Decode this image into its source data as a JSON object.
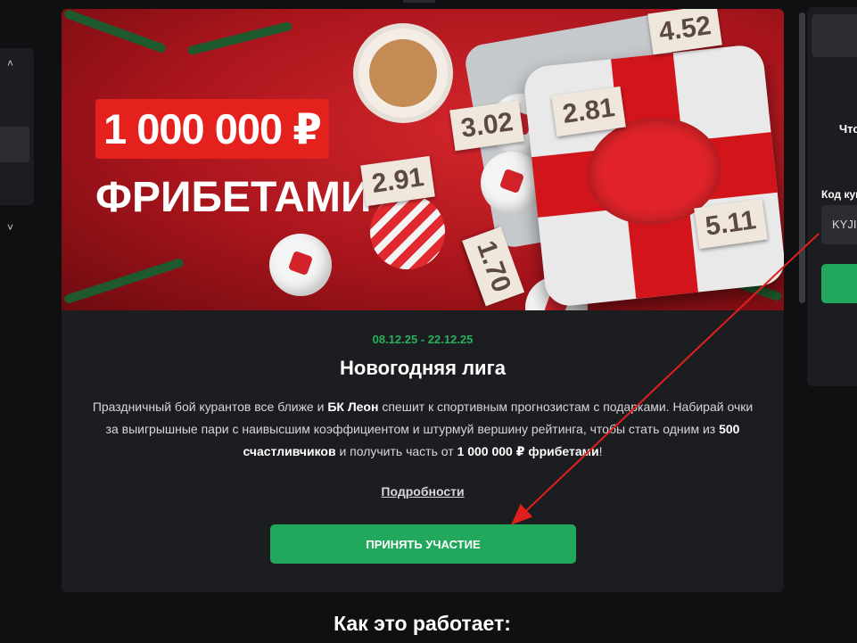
{
  "banner": {
    "amount": "1 000 000 ₽",
    "freebet": "ФРИБЕТАМИ",
    "odds": [
      "3.02",
      "2.91",
      "1.70",
      "2.81",
      "5.11",
      "4.52"
    ]
  },
  "promo": {
    "date_range": "08.12.25 - 22.12.25",
    "title": "Новогодняя лига",
    "desc_1": "Праздничный бой курантов все ближе и ",
    "desc_brand": "БК Леон",
    "desc_2": " спешит к спортивным прогнозистам с подарками. Набирай очки за выигрышные пари с наивысшим коэффициентом и штурмуй вершину рейтинга, чтобы стать одним из ",
    "desc_winners": "500 счастливчиков",
    "desc_3": " и получить часть от ",
    "desc_prize": "1 000 000 ₽ фрибетами",
    "desc_4": "!",
    "details_link": "Подробности",
    "cta_label": "ПРИНЯТЬ УЧАСТИЕ"
  },
  "section": {
    "how_it_works": "Как это работает:"
  },
  "right_panel": {
    "question_partial": "Что",
    "coupon_label_partial": "Код куп",
    "coupon_value_partial": "KYJI"
  },
  "colors": {
    "accent_green": "#22a85c",
    "date_green": "#27b15a",
    "banner_red": "#e5211d",
    "card_bg": "#1c1d21",
    "annotation_arrow": "#e0201c"
  },
  "icons": {
    "left_up": "chevron-up-icon",
    "left_down": "chevron-down-icon"
  }
}
